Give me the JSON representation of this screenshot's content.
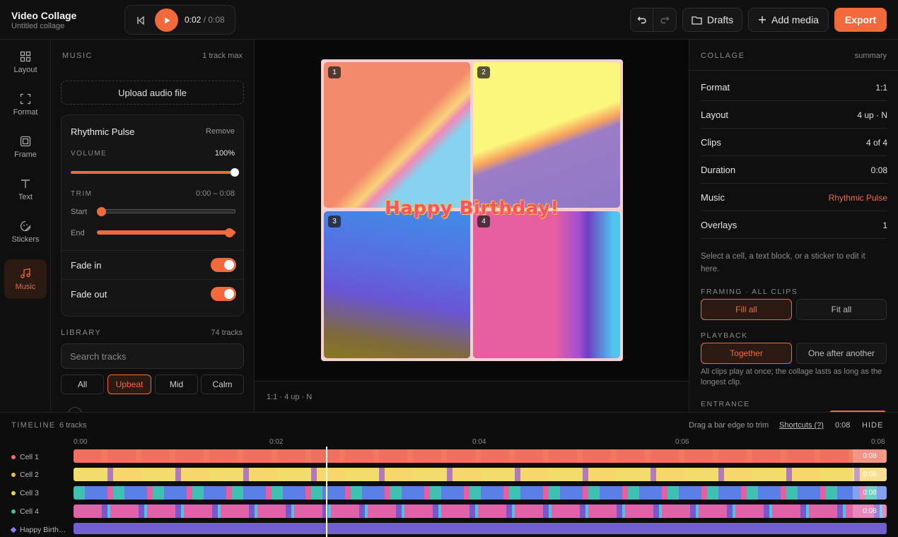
{
  "app": {
    "title": "Video Collage",
    "subtitle": "Untitled collage"
  },
  "transport": {
    "current": "0:02",
    "total": "/ 0:08"
  },
  "toolbar": {
    "drafts": "Drafts",
    "add_media": "Add media",
    "export": "Export"
  },
  "rail": [
    {
      "label": "Layout",
      "icon": "grid-icon"
    },
    {
      "label": "Format",
      "icon": "crop-icon"
    },
    {
      "label": "Frame",
      "icon": "frame-icon"
    },
    {
      "label": "Text",
      "icon": "text-icon"
    },
    {
      "label": "Stickers",
      "icon": "sticker-icon"
    },
    {
      "label": "Music",
      "icon": "music-icon",
      "active": true
    }
  ],
  "music": {
    "section": "MUSIC",
    "limit": "1 track max",
    "upload": "Upload audio file",
    "track": {
      "name": "Rhythmic Pulse",
      "remove": "Remove",
      "volume_label": "VOLUME",
      "volume_value": "100%",
      "volume_level": 1.0,
      "trim_label": "TRIM",
      "trim_value": "0:00 – 0:08",
      "start_label": "Start",
      "end_label": "End",
      "fade_in": "Fade in",
      "fade_out": "Fade out"
    },
    "library_label": "LIBRARY",
    "library_count": "74 tracks",
    "search_placeholder": "Search tracks",
    "filters": [
      "All",
      "Upbeat",
      "Mid",
      "Calm"
    ],
    "active_filter": "Upbeat"
  },
  "canvas": {
    "cells": [
      "1",
      "2",
      "3",
      "4"
    ],
    "overlay_text": "Happy Birthday!",
    "footer": "1:1 · 4 up · N"
  },
  "summary": {
    "section": "COLLAGE",
    "meta": "summary",
    "rows": [
      {
        "k": "Format",
        "v": "1:1"
      },
      {
        "k": "Layout",
        "v": "4 up · N"
      },
      {
        "k": "Clips",
        "v": "4 of 4"
      },
      {
        "k": "Duration",
        "v": "0:08"
      },
      {
        "k": "Music",
        "v": "Rhythmic Pulse"
      },
      {
        "k": "Overlays",
        "v": "1"
      }
    ],
    "hint": "Select a cell, a text block, or a sticker to edit it here.",
    "framing_label": "FRAMING · ALL CLIPS",
    "framing": [
      "Fill all",
      "Fit all"
    ],
    "playback_label": "PLAYBACK",
    "playback": [
      "Together",
      "One after another"
    ],
    "playback_desc": "All clips play at once; the collage lasts as long as the longest clip.",
    "entrance_label": "ENTRANCE"
  },
  "timeline": {
    "label": "TIMELINE",
    "count": "6 tracks",
    "hint": "Drag a bar edge to trim",
    "shortcuts": "Shortcuts (?)",
    "time": "0:08",
    "hide": "HIDE",
    "ticks": [
      "0:00",
      "0:02",
      "0:04",
      "0:06",
      "0:08"
    ],
    "playhead_seconds": 2.5,
    "tracks": [
      {
        "name": "Cell 1",
        "end": "0:08",
        "color": "#f07060"
      },
      {
        "name": "Cell 2",
        "end": "0:08",
        "color": "#f2b84b"
      },
      {
        "name": "Cell 3",
        "end": "0:08",
        "color": "#f2d24b"
      },
      {
        "name": "Cell 4",
        "end": "0:08",
        "color": "#3fc0a0"
      },
      {
        "name": "Happy Birth…",
        "end": "",
        "color": "#8f7cff"
      }
    ]
  },
  "colors": {
    "accent": "#f26a3b"
  }
}
